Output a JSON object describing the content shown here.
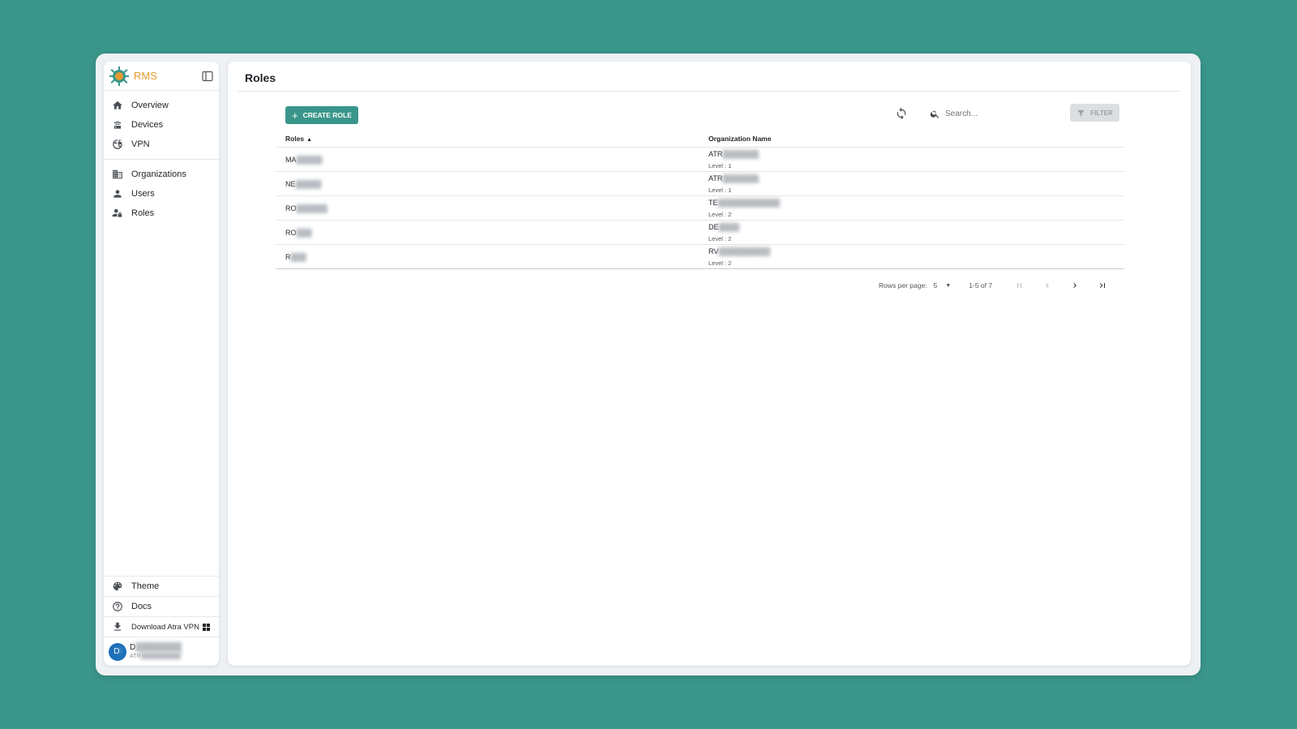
{
  "brand": {
    "name": "RMS",
    "accent": "#e69a2e"
  },
  "sidebar": {
    "primary": [
      {
        "label": "Overview",
        "icon": "home-icon"
      },
      {
        "label": "Devices",
        "icon": "router-icon"
      },
      {
        "label": "VPN",
        "icon": "vpn-globe-icon"
      }
    ],
    "secondary": [
      {
        "label": "Organizations",
        "icon": "building-icon"
      },
      {
        "label": "Users",
        "icon": "user-icon"
      },
      {
        "label": "Roles",
        "icon": "user-lock-icon"
      }
    ],
    "bottom": [
      {
        "label": "Theme",
        "icon": "palette-icon"
      },
      {
        "label": "Docs",
        "icon": "help-icon"
      },
      {
        "label": "Download Atra VPN",
        "icon": "download-icon"
      }
    ],
    "user": {
      "initials": "D",
      "name": "D",
      "org": "ATR"
    }
  },
  "page": {
    "title": "Roles",
    "create_label": "CREATE ROLE",
    "search_placeholder": "Search...",
    "filter_label": "FILTER"
  },
  "table": {
    "columns": [
      "Roles",
      "Organization Name"
    ],
    "sort_indicator": "▲",
    "rows": [
      {
        "role": "MA",
        "org": "ATR",
        "level": "Level : 1"
      },
      {
        "role": "NE",
        "org": "ATR",
        "level": "Level : 1"
      },
      {
        "role": "RO",
        "org": "TE",
        "level": "Level : 2"
      },
      {
        "role": "RO",
        "org": "DE",
        "level": "Level : 2"
      },
      {
        "role": "R",
        "org": "RV",
        "level": "Level : 2"
      }
    ]
  },
  "pagination": {
    "rows_per_page_label": "Rows per page:",
    "rows_per_page": "5",
    "range": "1-5 of 7"
  },
  "colors": {
    "background": "#3a968a",
    "primary_button": "#3a968a"
  }
}
